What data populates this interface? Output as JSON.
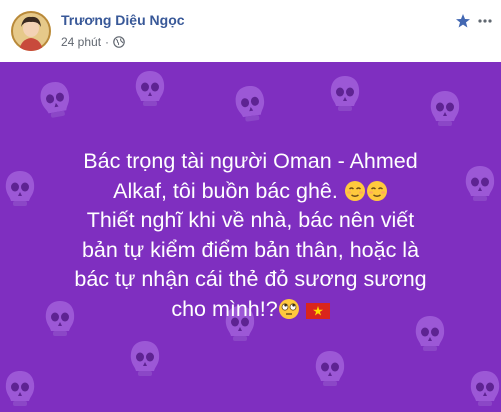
{
  "post": {
    "author_name": "Trương Diệu Ngọc",
    "timestamp": "24 phút",
    "audience_icon": "globe-icon",
    "header_icons": [
      "star-icon",
      "more-icon"
    ],
    "background_color": "#7f2fc0",
    "text_lines": [
      "Bác trọng tài người Oman - Ahmed",
      "Alkaf, tôi buồn bác ghê.",
      "Thiết nghĩ khi về nhà, bác nên viết",
      "bản tự kiểm điểm bản thân, hoặc là",
      "bác tự nhận cái thẻ đỏ sương sương",
      "cho mình!?"
    ],
    "emojis": [
      "relieved-face-emoji",
      "relieved-face-emoji",
      "rolling-eyes-emoji",
      "vietnam-flag-emoji"
    ]
  }
}
